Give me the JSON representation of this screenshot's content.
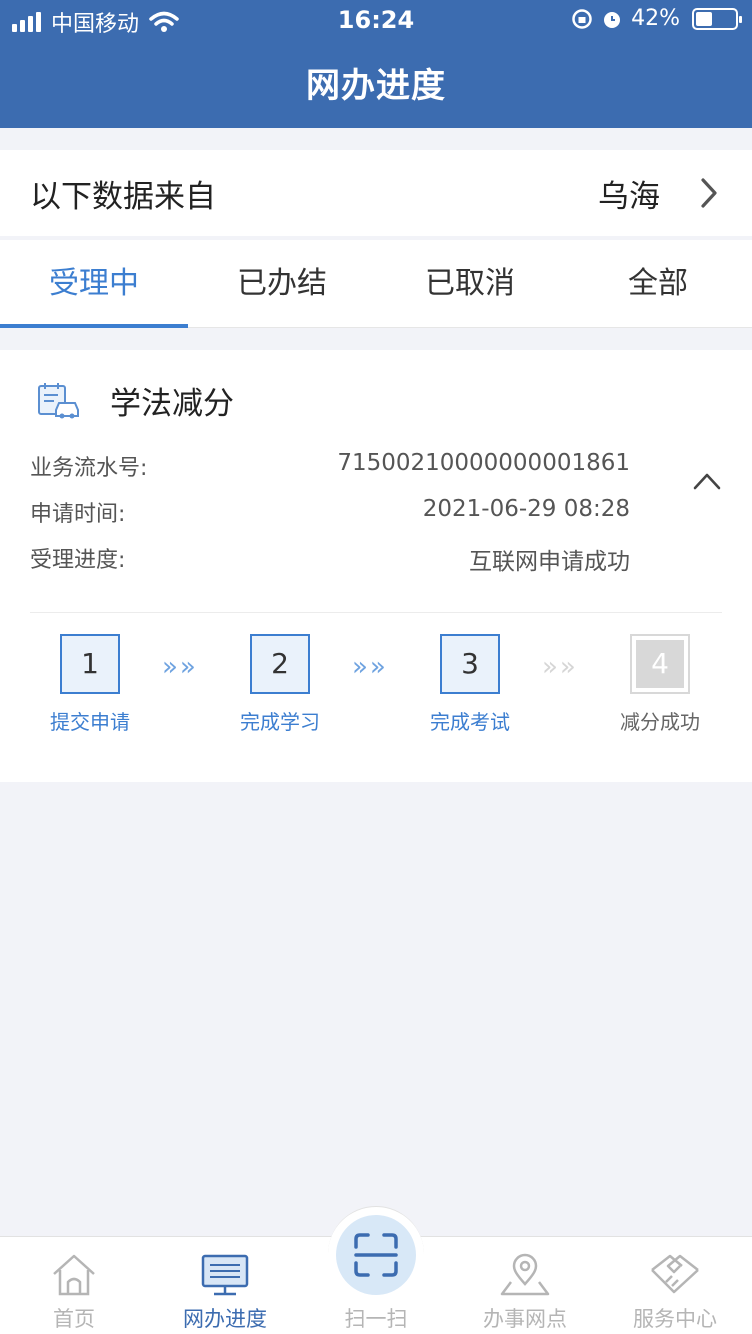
{
  "status_bar": {
    "carrier": "中国移动",
    "time": "16:24",
    "battery": "42%",
    "battery_level": 0.42
  },
  "header": {
    "title": "网办进度"
  },
  "source": {
    "label": "以下数据来自",
    "city": "乌海"
  },
  "tabs": [
    {
      "label": "受理中",
      "active": true
    },
    {
      "label": "已办结",
      "active": false
    },
    {
      "label": "已取消",
      "active": false
    },
    {
      "label": "全部",
      "active": false
    }
  ],
  "card": {
    "title": "学法减分",
    "icon": "license-car-icon",
    "rows": [
      {
        "key": "业务流水号:",
        "value": "71500210000000001861"
      },
      {
        "key": "申请时间:",
        "value": "2021-06-29 08:28"
      },
      {
        "key": "受理进度:",
        "value": "互联网申请成功"
      }
    ],
    "steps": [
      {
        "num": "1",
        "label": "提交申请",
        "done": true
      },
      {
        "num": "2",
        "label": "完成学习",
        "done": true
      },
      {
        "num": "3",
        "label": "完成考试",
        "done": true
      },
      {
        "num": "4",
        "label": "减分成功",
        "done": false
      }
    ],
    "arrow_glyph": "»»"
  },
  "nav": {
    "items": [
      {
        "label": "首页",
        "icon": "home-icon",
        "active": false
      },
      {
        "label": "网办进度",
        "icon": "monitor-icon",
        "active": true
      },
      {
        "label": "扫一扫",
        "icon": "scan-icon",
        "active": false
      },
      {
        "label": "办事网点",
        "icon": "location-icon",
        "active": false
      },
      {
        "label": "服务中心",
        "icon": "handshake-icon",
        "active": false
      }
    ]
  },
  "colors": {
    "primary": "#3c6cb0",
    "accent": "#3c7ed0",
    "muted": "#b5b5b5"
  }
}
